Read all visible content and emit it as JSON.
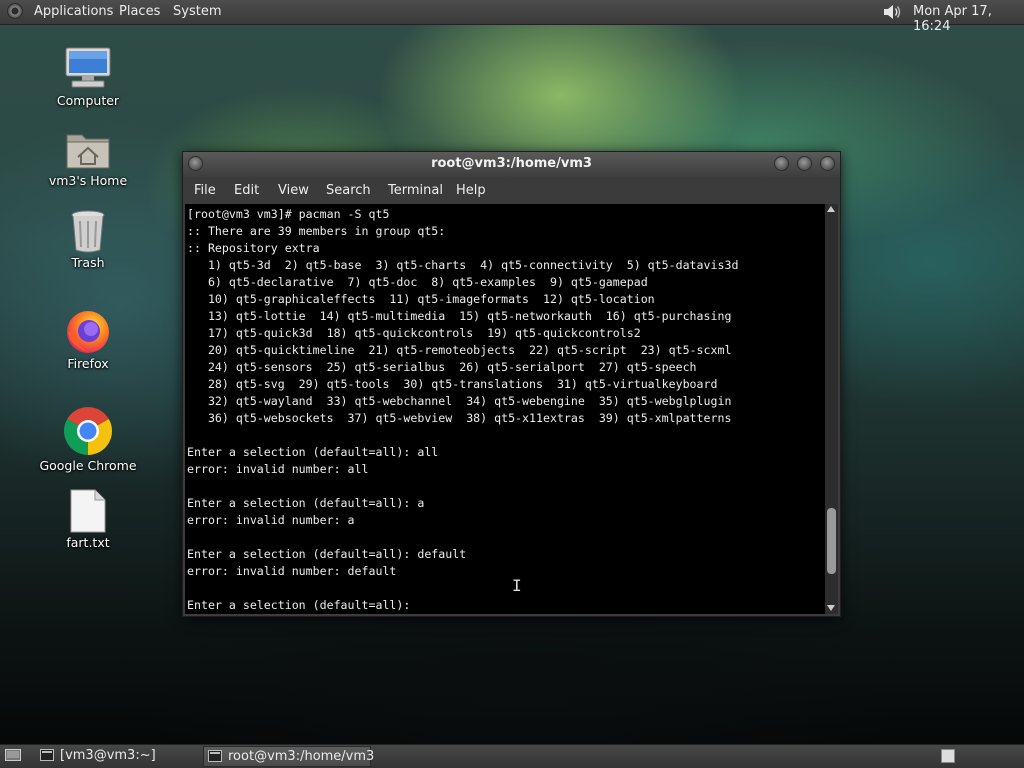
{
  "top_panel": {
    "menus": [
      "Applications",
      "Places",
      "System"
    ],
    "clock": "Mon Apr 17, 16:24",
    "volume_icon": "speaker-icon"
  },
  "desktop_icons": [
    {
      "label": "Computer",
      "icon": "computer-icon"
    },
    {
      "label": "vm3's Home",
      "icon": "home-folder-icon"
    },
    {
      "label": "Trash",
      "icon": "trash-icon"
    },
    {
      "label": "Firefox",
      "icon": "firefox-icon"
    },
    {
      "label": "Google Chrome",
      "icon": "chrome-icon"
    },
    {
      "label": "fart.txt",
      "icon": "text-file-icon"
    }
  ],
  "terminal": {
    "title": "root@vm3:/home/vm3",
    "menu": [
      "File",
      "Edit",
      "View",
      "Search",
      "Terminal",
      "Help"
    ],
    "lines": [
      "[root@vm3 vm3]# pacman -S qt5",
      ":: There are 39 members in group qt5:",
      ":: Repository extra",
      "   1) qt5-3d  2) qt5-base  3) qt5-charts  4) qt5-connectivity  5) qt5-datavis3d",
      "   6) qt5-declarative  7) qt5-doc  8) qt5-examples  9) qt5-gamepad",
      "   10) qt5-graphicaleffects  11) qt5-imageformats  12) qt5-location",
      "   13) qt5-lottie  14) qt5-multimedia  15) qt5-networkauth  16) qt5-purchasing",
      "   17) qt5-quick3d  18) qt5-quickcontrols  19) qt5-quickcontrols2",
      "   20) qt5-quicktimeline  21) qt5-remoteobjects  22) qt5-script  23) qt5-scxml",
      "   24) qt5-sensors  25) qt5-serialbus  26) qt5-serialport  27) qt5-speech",
      "   28) qt5-svg  29) qt5-tools  30) qt5-translations  31) qt5-virtualkeyboard",
      "   32) qt5-wayland  33) qt5-webchannel  34) qt5-webengine  35) qt5-webglplugin",
      "   36) qt5-websockets  37) qt5-webview  38) qt5-x11extras  39) qt5-xmlpatterns",
      "",
      "Enter a selection (default=all): all",
      "error: invalid number: all",
      "",
      "Enter a selection (default=all): a",
      "error: invalid number: a",
      "",
      "Enter a selection (default=all): default",
      "error: invalid number: default",
      "",
      "Enter a selection (default=all):"
    ],
    "scrollbar": {
      "position_fraction": 0.9
    }
  },
  "taskbar": {
    "tasks": [
      {
        "label": "[vm3@vm3:~]",
        "active": false
      },
      {
        "label": "root@vm3:/home/vm3",
        "active": true
      }
    ]
  }
}
